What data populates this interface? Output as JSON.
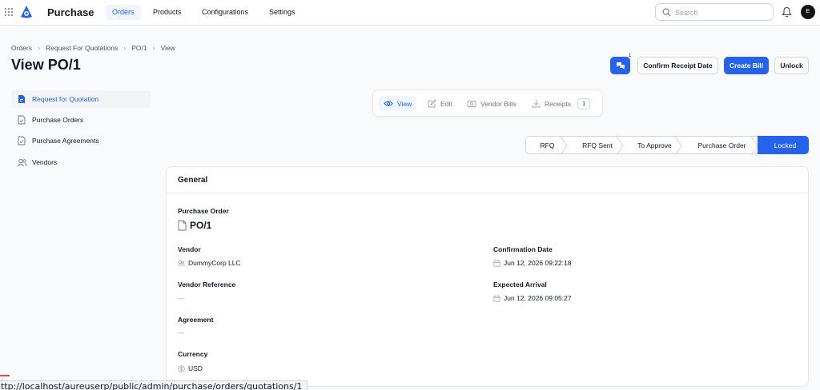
{
  "topbar": {
    "app_title": "Purchase",
    "nav": [
      "Orders",
      "Products",
      "Configurations",
      "Settings"
    ],
    "active_nav": "Orders",
    "search_placeholder": "Search",
    "avatar_initial": "E"
  },
  "header": {
    "breadcrumb": [
      "Orders",
      "Request For Quotations",
      "PO/1",
      "View"
    ],
    "title": "View PO/1",
    "chat_badge": "1",
    "actions": {
      "confirm_receipt": "Confirm Receipt Date",
      "create_bill": "Create Bill",
      "unlock": "Unlock"
    }
  },
  "sidebar": {
    "items": [
      {
        "label": "Request for Quotation",
        "icon": "document-icon",
        "active": true
      },
      {
        "label": "Purchase Orders",
        "icon": "document-check-icon",
        "active": false
      },
      {
        "label": "Purchase Agreements",
        "icon": "document-check-icon",
        "active": false
      },
      {
        "label": "Vendors",
        "icon": "users-icon",
        "active": false
      }
    ]
  },
  "tabs": {
    "view": "View",
    "edit": "Edit",
    "vendor_bills": "Vendor Bills",
    "receipts": "Receipts",
    "receipts_count": "1"
  },
  "status_steps": [
    "RFQ",
    "RFQ Sent",
    "To Approve",
    "Purchase Order",
    "Locked"
  ],
  "active_status": "Locked",
  "card": {
    "title": "General",
    "purchase_order_label": "Purchase Order",
    "purchase_order_value": "PO/1",
    "vendor_label": "Vendor",
    "vendor_value": "DummyCorp LLC",
    "vendor_reference_label": "Vendor Reference",
    "vendor_reference_value": "—",
    "agreement_label": "Agreement",
    "agreement_value": "—",
    "currency_label": "Currency",
    "currency_value": "USD",
    "confirmation_date_label": "Confirmation Date",
    "confirmation_date_value": "Jun 12, 2026 09:22:18",
    "expected_arrival_label": "Expected Arrival",
    "expected_arrival_value": "Jun 12, 2026 09:05:27"
  },
  "status_url": "http://localhost/aureuserp/public/admin/purchase/orders/quotations/1",
  "colors": {
    "primary": "#2563eb",
    "primary_light": "#eff6ff"
  }
}
